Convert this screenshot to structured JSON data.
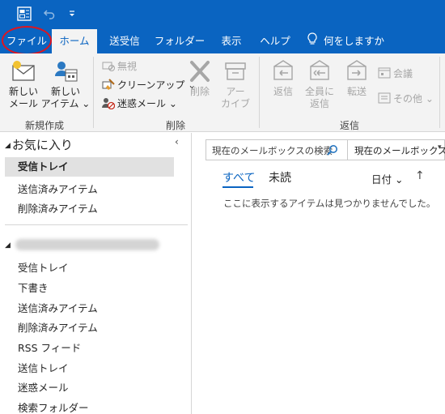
{
  "titlebar": {
    "icons": [
      "outlook-app-icon",
      "undo-icon",
      "qat-customize-icon"
    ]
  },
  "tabs": [
    {
      "label": "ファイル",
      "active": false
    },
    {
      "label": "ホーム",
      "active": true
    },
    {
      "label": "送受信",
      "active": false
    },
    {
      "label": "フォルダー",
      "active": false
    },
    {
      "label": "表示",
      "active": false
    },
    {
      "label": "ヘルプ",
      "active": false
    },
    {
      "label": "何をしますか",
      "active": false
    }
  ],
  "ribbon": {
    "new": {
      "new_mail_l1": "新しい",
      "new_mail_l2": "メール",
      "new_items_l1": "新しい",
      "new_items_l2": "アイテム ⌄",
      "group": "新規作成"
    },
    "delete": {
      "ignore": "無視",
      "cleanup": "クリーンアップ ⌄",
      "junk": "迷惑メール ⌄",
      "delete": "削除",
      "archive_l1": "アー",
      "archive_l2": "カイブ",
      "group": "削除"
    },
    "respond": {
      "reply": "返信",
      "reply_all_l1": "全員に",
      "reply_all_l2": "返信",
      "forward": "転送",
      "meeting": "会議",
      "more": "その他 ⌄",
      "group": "返信"
    }
  },
  "left": {
    "fav_label": "お気に入り",
    "fav_items": [
      "受信トレイ",
      "送信済みアイテム",
      "削除済みアイテム"
    ],
    "account_items": [
      "受信トレイ",
      "下書き",
      "送信済みアイテム",
      "削除済みアイテム",
      "RSS フィード",
      "送信トレイ",
      "迷惑メール",
      "検索フォルダー"
    ],
    "collapse_glyph": "‹",
    "expand_glyph": "◢"
  },
  "right": {
    "search_placeholder": "現在のメールボックスの検索",
    "scope": "現在のメールボックス",
    "filter_all": "すべて",
    "filter_unread": "未読",
    "sort_label": "日付 ⌄",
    "sort_dir": "↑",
    "empty": "ここに表示するアイテムは見つかりませんでした。"
  },
  "colors": {
    "accent": "#0a64c1",
    "annotation": "#e0141e"
  }
}
